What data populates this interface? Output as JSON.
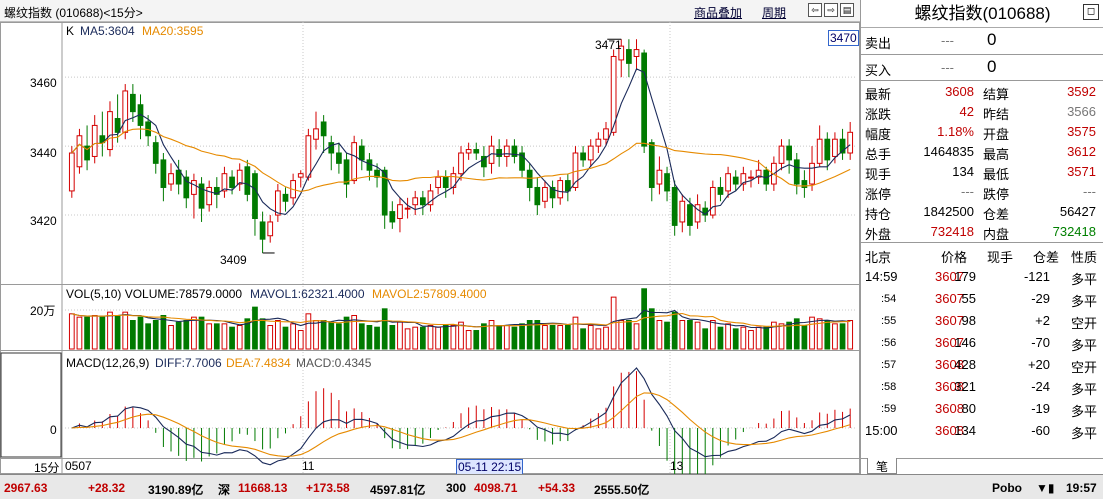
{
  "header": {
    "title": "螺纹指数 (010688)<15分>",
    "overlay_label": "商品叠加",
    "period_label": "周期"
  },
  "kline": {
    "k_label": "K",
    "ma5_label": "MA5:3604",
    "ma20_label": "MA20:3595",
    "price_ticks": [
      "3460",
      "3440",
      "3420"
    ],
    "high_label": "3471",
    "low_label": "3409",
    "current_price_label": "3470"
  },
  "volume": {
    "label": "VOL(5,10) VOLUME:78579.0000",
    "mavol1": "MAVOL1:62321.4000",
    "mavol2": "MAVOL2:57809.4000",
    "tick": "20万"
  },
  "macd": {
    "label": "MACD(12,26,9)",
    "diff": "DIFF:7.7006",
    "dea": "DEA:7.4834",
    "macd": "MACD:0.4345",
    "zero_tick": "0"
  },
  "xaxis": {
    "period": "15分",
    "labels": [
      "0507",
      "11",
      "13"
    ],
    "cursor_time": "05-11 22:15"
  },
  "panel": {
    "title": "螺纹指数(010688)",
    "sell_label": "卖出",
    "sell_price": "---",
    "sell_vol": "0",
    "buy_label": "买入",
    "buy_price": "---",
    "buy_vol": "0",
    "quotes": [
      {
        "l1": "最新",
        "v1": "3608",
        "c1": "red",
        "l2": "结算",
        "v2": "3592",
        "c2": "red"
      },
      {
        "l1": "涨跌",
        "v1": "42",
        "c1": "red",
        "l2": "昨结",
        "v2": "3566",
        "c2": "dash"
      },
      {
        "l1": "幅度",
        "v1": "1.18%",
        "c1": "red",
        "l2": "开盘",
        "v2": "3575",
        "c2": "red"
      },
      {
        "l1": "总手",
        "v1": "1464835",
        "c1": "black",
        "l2": "最高",
        "v2": "3612",
        "c2": "red"
      },
      {
        "l1": "现手",
        "v1": "134",
        "c1": "black",
        "l2": "最低",
        "v2": "3571",
        "c2": "red"
      },
      {
        "l1": "涨停",
        "v1": "---",
        "c1": "dash",
        "l2": "跌停",
        "v2": "---",
        "c2": "dash"
      },
      {
        "l1": "持仓",
        "v1": "1842500",
        "c1": "black",
        "l2": "仓差",
        "v2": "56427",
        "c2": "black"
      },
      {
        "l1": "外盘",
        "v1": "732418",
        "c1": "red",
        "l2": "内盘",
        "v2": "732418",
        "c2": "green"
      }
    ],
    "tick_header": {
      "city": "北京",
      "price": "价格",
      "vol": "现手",
      "oi": "仓差",
      "nature": "性质"
    },
    "ticks": [
      {
        "time": "14:59",
        "price": "3607",
        "vol": "179",
        "oi": "-121",
        "nature": "多平",
        "nc": "black"
      },
      {
        "time": ":54",
        "price": "3607",
        "vol": "55",
        "oi": "-29",
        "nature": "多平",
        "nc": "black"
      },
      {
        "time": ":55",
        "price": "3607",
        "vol": "98",
        "oi": "+2",
        "nature": "空开",
        "nc": "black"
      },
      {
        "time": ":56",
        "price": "3607",
        "vol": "146",
        "oi": "-70",
        "nature": "多平",
        "nc": "black"
      },
      {
        "time": ":57",
        "price": "3608",
        "vol": "428",
        "oi": "+20",
        "nature": "空开",
        "nc": "black"
      },
      {
        "time": ":58",
        "price": "3608",
        "vol": "321",
        "oi": "-24",
        "nature": "多平",
        "nc": "black"
      },
      {
        "time": ":59",
        "price": "3608",
        "vol": "80",
        "oi": "-19",
        "nature": "多平",
        "nc": "black"
      },
      {
        "time": "15:00",
        "price": "3608",
        "vol": "134",
        "oi": "-60",
        "nature": "多平",
        "nc": "black"
      }
    ],
    "tab_label": "笔"
  },
  "status_bar": {
    "i1_value": "2967.63",
    "i1_change": "+28.32",
    "i1_amount": "3190.89亿",
    "i2_name": "深",
    "i2_value": "11668.13",
    "i2_change": "+173.58",
    "i2_amount": "4597.81亿",
    "i3_name": "300",
    "i3_value": "4098.71",
    "i3_change": "+54.33",
    "i3_amount": "2555.50亿",
    "brand": "Pobo",
    "clock": "19:57"
  },
  "colors": {
    "up": "#d40000",
    "down": "#007a00",
    "ma5": "#1a2a5a",
    "ma20": "#e68a00",
    "grid": "#c8c8c8"
  },
  "chart_data": {
    "type": "candlestick",
    "price_ylim": [
      3400,
      3476
    ],
    "candles": [
      [
        3427,
        3438,
        3425,
        3440
      ],
      [
        3434,
        3443,
        3432,
        3445
      ],
      [
        3440,
        3436,
        3433,
        3446
      ],
      [
        3437,
        3446,
        3435,
        3449
      ],
      [
        3443,
        3441,
        3437,
        3450
      ],
      [
        3439,
        3450,
        3437,
        3453
      ],
      [
        3448,
        3444,
        3441,
        3455
      ],
      [
        3444,
        3456,
        3442,
        3458
      ],
      [
        3455,
        3450,
        3447,
        3458
      ],
      [
        3452,
        3446,
        3442,
        3455
      ],
      [
        3447,
        3443,
        3440,
        3449
      ],
      [
        3441,
        3435,
        3432,
        3443
      ],
      [
        3436,
        3428,
        3424,
        3438
      ],
      [
        3429,
        3432,
        3427,
        3435
      ],
      [
        3433,
        3429,
        3426,
        3436
      ],
      [
        3431,
        3425,
        3422,
        3433
      ],
      [
        3426,
        3430,
        3419,
        3432
      ],
      [
        3429,
        3422,
        3418,
        3431
      ],
      [
        3423,
        3428,
        3421,
        3430
      ],
      [
        3428,
        3426,
        3422,
        3431
      ],
      [
        3427,
        3432,
        3425,
        3434
      ],
      [
        3431,
        3428,
        3426,
        3433
      ],
      [
        3429,
        3433,
        3427,
        3435
      ],
      [
        3434,
        3426,
        3424,
        3436
      ],
      [
        3432,
        3419,
        3414,
        3433
      ],
      [
        3418,
        3413,
        3409,
        3421
      ],
      [
        3414,
        3418,
        3412,
        3420
      ],
      [
        3420,
        3427,
        3418,
        3429
      ],
      [
        3426,
        3424,
        3421,
        3428
      ],
      [
        3425,
        3430,
        3423,
        3432
      ],
      [
        3431,
        3432,
        3428,
        3433
      ],
      [
        3431,
        3443,
        3430,
        3445
      ],
      [
        3442,
        3445,
        3439,
        3450
      ],
      [
        3447,
        3443,
        3438,
        3449
      ],
      [
        3441,
        3438,
        3433,
        3443
      ],
      [
        3438,
        3435,
        3432,
        3441
      ],
      [
        3436,
        3429,
        3425,
        3438
      ],
      [
        3430,
        3441,
        3429,
        3443
      ],
      [
        3440,
        3436,
        3433,
        3442
      ],
      [
        3436,
        3433,
        3430,
        3438
      ],
      [
        3433,
        3431,
        3428,
        3435
      ],
      [
        3433,
        3420,
        3416,
        3434
      ],
      [
        3421,
        3418,
        3416,
        3424
      ],
      [
        3419,
        3423,
        3415,
        3425
      ],
      [
        3422,
        3422,
        3419,
        3425
      ],
      [
        3423,
        3425,
        3420,
        3427
      ],
      [
        3425,
        3423,
        3420,
        3427
      ],
      [
        3423,
        3427,
        3421,
        3429
      ],
      [
        3428,
        3431,
        3426,
        3433
      ],
      [
        3431,
        3428,
        3425,
        3433
      ],
      [
        3428,
        3432,
        3426,
        3434
      ],
      [
        3432,
        3438,
        3430,
        3440
      ],
      [
        3438,
        3439,
        3436,
        3441
      ],
      [
        3439,
        3438,
        3436,
        3441
      ],
      [
        3437,
        3434,
        3431,
        3440
      ],
      [
        3435,
        3440,
        3432,
        3443
      ],
      [
        3439,
        3437,
        3434,
        3442
      ],
      [
        3437,
        3440,
        3434,
        3442
      ],
      [
        3440,
        3437,
        3435,
        3442
      ],
      [
        3438,
        3433,
        3431,
        3440
      ],
      [
        3433,
        3428,
        3424,
        3435
      ],
      [
        3428,
        3423,
        3420,
        3431
      ],
      [
        3424,
        3428,
        3422,
        3430
      ],
      [
        3428,
        3425,
        3422,
        3430
      ],
      [
        3425,
        3430,
        3423,
        3431
      ],
      [
        3430,
        3427,
        3424,
        3432
      ],
      [
        3428,
        3438,
        3427,
        3440
      ],
      [
        3438,
        3436,
        3434,
        3440
      ],
      [
        3436,
        3440,
        3434,
        3442
      ],
      [
        3440,
        3442,
        3438,
        3444
      ],
      [
        3442,
        3445,
        3440,
        3447
      ],
      [
        3444,
        3466,
        3443,
        3468
      ],
      [
        3465,
        3469,
        3460,
        3471
      ],
      [
        3468,
        3464,
        3460,
        3471
      ],
      [
        3466,
        3468,
        3462,
        3471
      ],
      [
        3467,
        3440,
        3438,
        3468
      ],
      [
        3441,
        3428,
        3424,
        3442
      ],
      [
        3429,
        3433,
        3426,
        3437
      ],
      [
        3432,
        3427,
        3424,
        3434
      ],
      [
        3428,
        3417,
        3414,
        3430
      ],
      [
        3418,
        3424,
        3415,
        3426
      ],
      [
        3423,
        3417,
        3414,
        3425
      ],
      [
        3418,
        3423,
        3416,
        3426
      ],
      [
        3422,
        3420,
        3418,
        3424
      ],
      [
        3420,
        3428,
        3419,
        3430
      ],
      [
        3428,
        3426,
        3424,
        3431
      ],
      [
        3427,
        3432,
        3425,
        3434
      ],
      [
        3431,
        3429,
        3427,
        3433
      ],
      [
        3429,
        3432,
        3427,
        3434
      ],
      [
        3431,
        3431,
        3428,
        3433
      ],
      [
        3431,
        3433,
        3429,
        3436
      ],
      [
        3433,
        3429,
        3427,
        3434
      ],
      [
        3429,
        3435,
        3427,
        3437
      ],
      [
        3435,
        3440,
        3433,
        3442
      ],
      [
        3440,
        3436,
        3432,
        3442
      ],
      [
        3436,
        3429,
        3426,
        3438
      ],
      [
        3430,
        3428,
        3425,
        3433
      ],
      [
        3429,
        3435,
        3427,
        3440
      ],
      [
        3435,
        3442,
        3434,
        3446
      ],
      [
        3442,
        3436,
        3433,
        3444
      ],
      [
        3437,
        3442,
        3435,
        3444
      ],
      [
        3442,
        3438,
        3436,
        3445
      ],
      [
        3438,
        3444,
        3436,
        3447
      ]
    ],
    "volume_max": 230000
  }
}
